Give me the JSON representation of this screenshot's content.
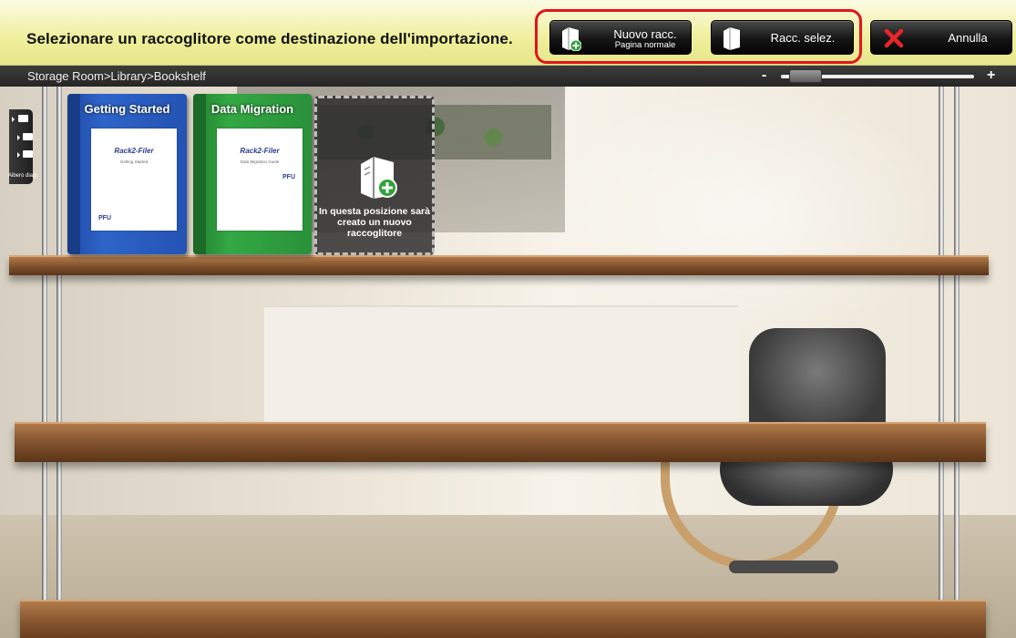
{
  "header": {
    "prompt": "Selezionare un raccoglitore come destinazione dell'importazione.",
    "buttons": {
      "new_binder": {
        "label": "Nuovo racc.",
        "sublabel": "Pagina normale",
        "icon": "new-binder-icon"
      },
      "selected_binder": {
        "label": "Racc. selez.",
        "icon": "binder-icon"
      },
      "cancel": {
        "label": "Annulla",
        "icon": "close-icon"
      }
    },
    "highlight_color": "#e1141b"
  },
  "pathbar": {
    "path": "Storage Room>Library>Bookshelf",
    "zoom_minus": "-",
    "zoom_plus": "+",
    "zoom_level": 0.05
  },
  "tree_tab": {
    "label": "Albero diagr."
  },
  "shelf": {
    "binders": [
      {
        "title": "Getting Started",
        "color": "#2a5ec0",
        "brand": "Rack2-Filer",
        "doc": "Getting Started",
        "maker": "PFU"
      },
      {
        "title": "Data Migration",
        "color": "#2f9a3c",
        "brand": "Rack2-Filer",
        "doc": "Data Migration Guide",
        "maker": "PFU"
      }
    ],
    "new_slot_text": "In questa posizione sarà creato un nuovo raccoglitore",
    "new_slot_icon": "new-binder-icon"
  }
}
